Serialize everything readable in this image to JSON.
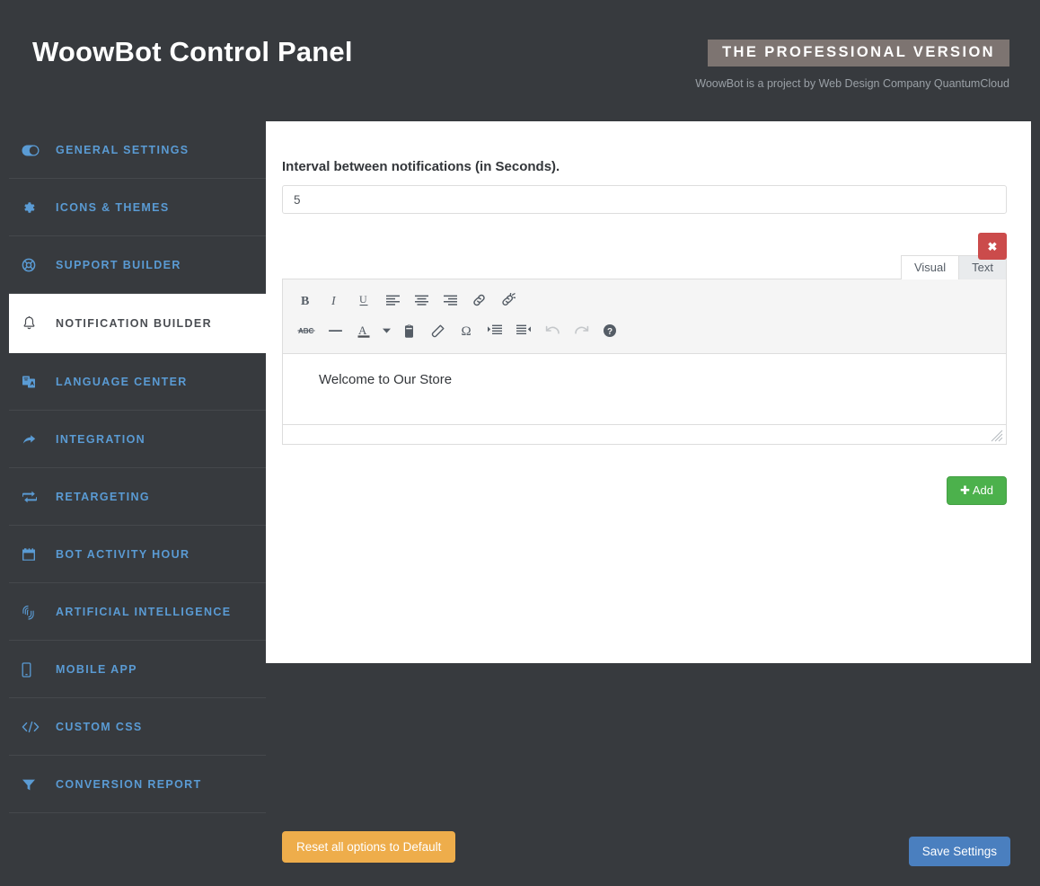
{
  "header": {
    "title": "WoowBot Control Panel",
    "pro_badge": "THE PROFESSIONAL VERSION",
    "credit": "WoowBot is a project by Web Design Company QuantumCloud"
  },
  "sidebar": {
    "items": [
      {
        "label": "General Settings",
        "icon": "toggle-icon",
        "active": false
      },
      {
        "label": "Icons & Themes",
        "icon": "gear-icon",
        "active": false
      },
      {
        "label": "Support Builder",
        "icon": "lifebuoy-icon",
        "active": false
      },
      {
        "label": "Notification Builder",
        "icon": "bell-icon",
        "active": true
      },
      {
        "label": "Language Center",
        "icon": "language-icon",
        "active": false
      },
      {
        "label": "Integration",
        "icon": "share-arrow-icon",
        "active": false
      },
      {
        "label": "Retargeting",
        "icon": "retarget-icon",
        "active": false
      },
      {
        "label": "Bot Activity Hour",
        "icon": "calendar-icon",
        "active": false
      },
      {
        "label": "Artificial Intelligence",
        "icon": "fingerprint-icon",
        "active": false
      },
      {
        "label": "Mobile App",
        "icon": "mobile-icon",
        "active": false
      },
      {
        "label": "Custom CSS",
        "icon": "code-icon",
        "active": false
      },
      {
        "label": "Conversion Report",
        "icon": "funnel-icon",
        "active": false
      }
    ]
  },
  "main": {
    "interval_label": "Interval between notifications (in Seconds).",
    "interval_value": "5",
    "interval_placeholder": "",
    "editor": {
      "tabs": [
        {
          "label": "Visual",
          "active": true
        },
        {
          "label": "Text",
          "active": false
        }
      ],
      "close_label": "✖",
      "content": "Welcome to Our Store",
      "toolbar_row1": [
        {
          "name": "bold-icon",
          "title": "Bold"
        },
        {
          "name": "italic-icon",
          "title": "Italic"
        },
        {
          "name": "underline-icon",
          "title": "Underline"
        },
        {
          "name": "align-left-icon",
          "title": "Align left"
        },
        {
          "name": "align-center-icon",
          "title": "Align center"
        },
        {
          "name": "align-right-icon",
          "title": "Align right"
        },
        {
          "name": "link-icon",
          "title": "Insert link"
        },
        {
          "name": "unlink-icon",
          "title": "Remove link"
        }
      ],
      "toolbar_row2": [
        {
          "name": "strikethrough-icon",
          "title": "Strikethrough"
        },
        {
          "name": "horizontal-rule-icon",
          "title": "Horizontal line"
        },
        {
          "name": "text-color-icon",
          "title": "Text color"
        },
        {
          "name": "paste-icon",
          "title": "Paste as text"
        },
        {
          "name": "clear-formatting-icon",
          "title": "Clear formatting"
        },
        {
          "name": "special-character-icon",
          "title": "Special character"
        },
        {
          "name": "indent-icon",
          "title": "Increase indent"
        },
        {
          "name": "outdent-icon",
          "title": "Decrease indent"
        },
        {
          "name": "undo-icon",
          "title": "Undo"
        },
        {
          "name": "redo-icon",
          "title": "Redo"
        },
        {
          "name": "help-icon",
          "title": "Keyboard shortcuts"
        }
      ]
    },
    "add_button": "Add"
  },
  "footer": {
    "reset_label": "Reset all options to Default",
    "save_label": "Save Settings"
  },
  "colors": {
    "background": "#373a3e",
    "accent_blue": "#5a9bd4",
    "panel": "#ffffff",
    "add_green": "#4cb14c",
    "reset_orange": "#eead4b",
    "save_blue": "#4a7fbf",
    "close_red": "#cb4b4b"
  }
}
